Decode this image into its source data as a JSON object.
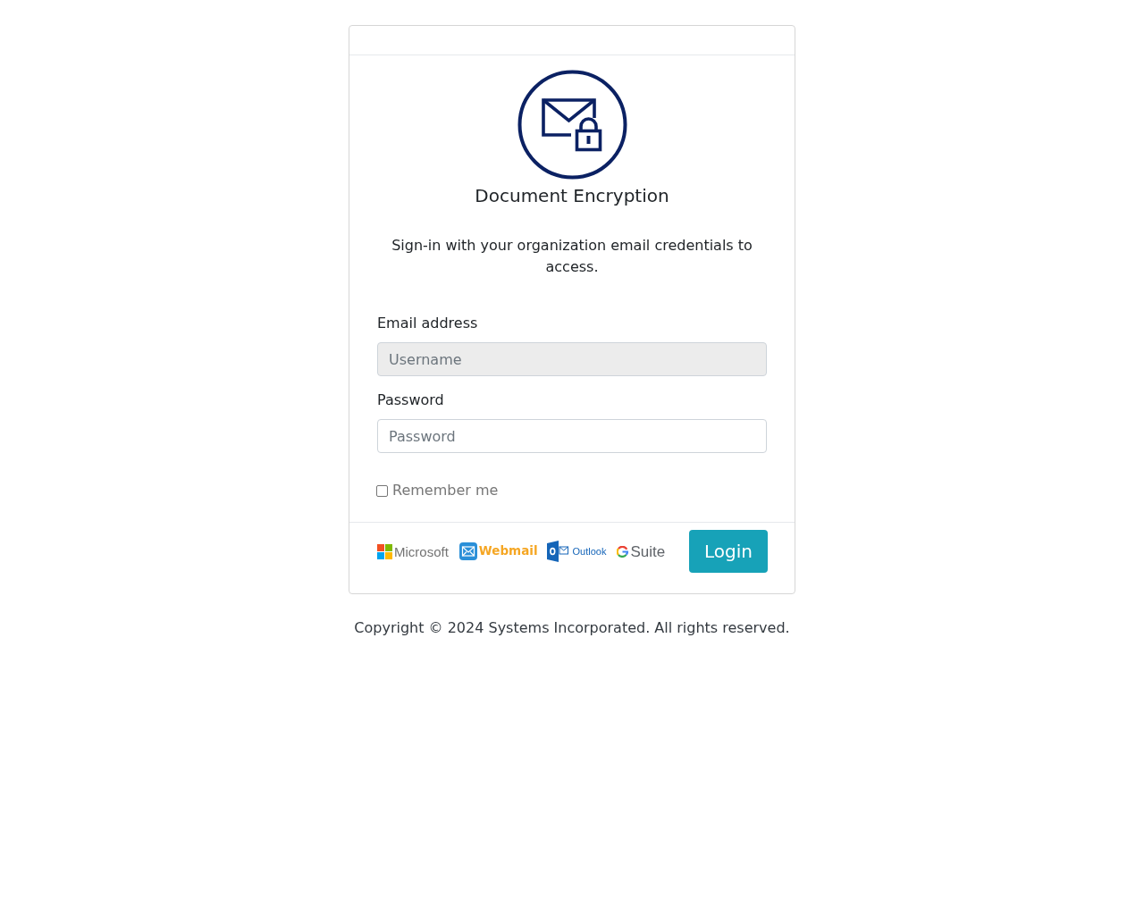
{
  "app": {
    "title": "Document Encryption",
    "instructions": "Sign-in with your organization email credentials to access."
  },
  "form": {
    "fields": [
      {
        "label": "Email address",
        "placeholder": "Username",
        "disabled": true
      },
      {
        "label": "Password",
        "placeholder": "Password",
        "disabled": false
      }
    ],
    "remember": {
      "label": "Remember me",
      "checked": false
    }
  },
  "footer": {
    "providers": [
      {
        "kind": "microsoft",
        "label": "Microsoft"
      },
      {
        "kind": "webmail",
        "label": "Webmail"
      },
      {
        "kind": "outlook",
        "label": "Outlook"
      },
      {
        "kind": "gsuite",
        "label": "Suite"
      }
    ],
    "login_button": "Login"
  },
  "copyright": "Copyright © 2024 Systems Incorporated. All rights reserved."
}
